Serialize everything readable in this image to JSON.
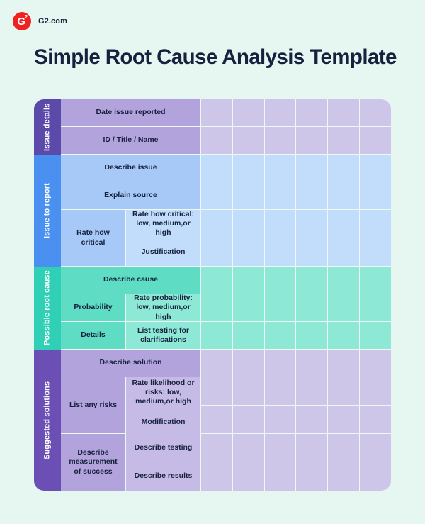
{
  "brand": {
    "logo_icon": "g2-logo-icon",
    "logo_letter": "G",
    "logo_superscript": "2",
    "name": "G2.com"
  },
  "page_title": "Simple Root Cause Analysis Template",
  "colors": {
    "page_background": "#e6f7f2",
    "text": "#16213e",
    "brand_red": "#ef2121",
    "issue_details_label": "#5c4aab",
    "issue_details_cell": "#b3a3dd",
    "issue_details_blank": "#cec6e8",
    "issue_report_label": "#4a90f0",
    "issue_report_cell": "#a6c9f8",
    "issue_report_blank": "#c2dcfb",
    "root_cause_label": "#2fd0b5",
    "root_cause_cell": "#5fdcc4",
    "root_cause_blank": "#8ee8d6",
    "solutions_label": "#6b4fb5",
    "solutions_cell": "#b3a3dd",
    "solutions_blank": "#cec6e8",
    "grid_line": "#eef8f5"
  },
  "table": {
    "blank_column_count": 6,
    "sections": [
      {
        "label": "Issue details",
        "rows": [
          {
            "primary": "Date issue reported"
          },
          {
            "primary": "ID / Title / Name"
          }
        ]
      },
      {
        "label": "Issue to report",
        "rows": [
          {
            "primary": "Describe issue"
          },
          {
            "primary": "Explain source"
          },
          {
            "primary": "Rate how critical",
            "subs": [
              "Rate how critical: low, medium,or high",
              "Justification"
            ]
          }
        ]
      },
      {
        "label": "Possible root cause",
        "rows": [
          {
            "primary": "Describe cause"
          },
          {
            "primary": "Probability",
            "subs": [
              "Rate probability: low, medium,or high"
            ]
          },
          {
            "primary": "Details",
            "subs": [
              "List testing for clarifications"
            ]
          }
        ]
      },
      {
        "label": "Suggested solutions",
        "rows": [
          {
            "primary": "Describe solution"
          },
          {
            "primary": "List any risks",
            "subs": [
              "Rate likelihood or risks: low, medium,or high",
              "Modification"
            ]
          },
          {
            "primary": "Describe measurement of success",
            "subs": [
              "Describe testing",
              "Describe results"
            ]
          }
        ]
      }
    ]
  }
}
